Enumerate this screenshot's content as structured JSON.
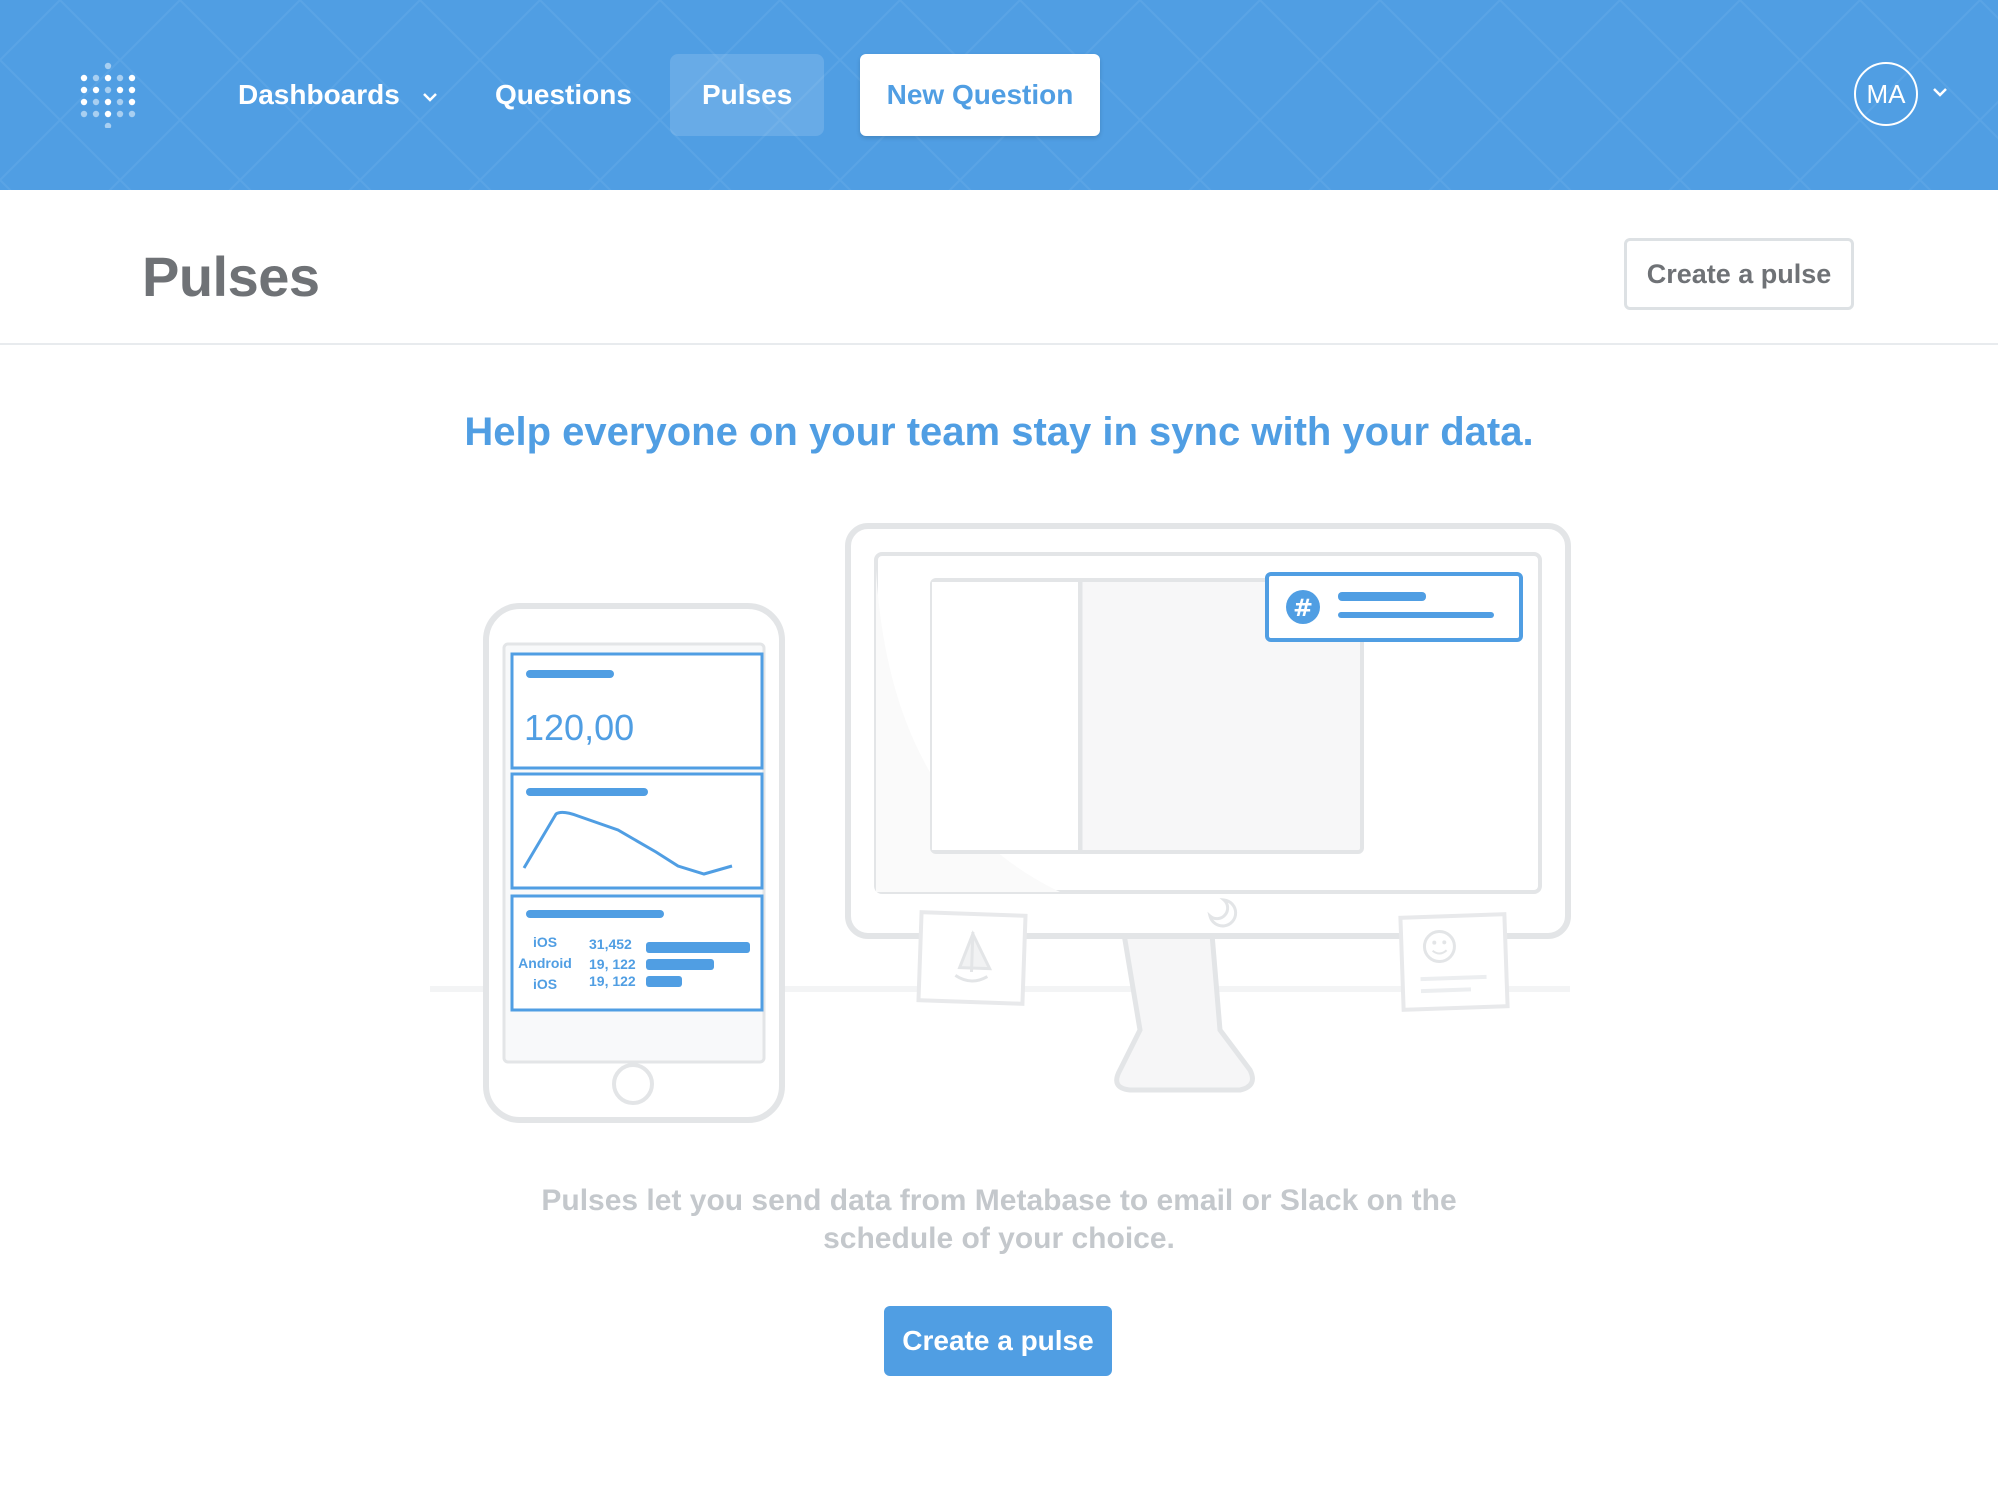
{
  "nav": {
    "items": [
      {
        "label": "Dashboards"
      },
      {
        "label": "Questions"
      },
      {
        "label": "Pulses"
      }
    ],
    "new_question_label": "New Question",
    "user_initials": "MA"
  },
  "header": {
    "title": "Pulses",
    "create_button_label": "Create a pulse"
  },
  "empty_state": {
    "headline": "Help everyone on your team stay in sync with your data.",
    "description": "Pulses let you send data from Metabase to email or Slack on the schedule of your choice.",
    "cta_label": "Create a pulse"
  },
  "illustration": {
    "phone_scalar_value": "120,00",
    "phone_rows": [
      {
        "label": "iOS",
        "value": "31,452"
      },
      {
        "label": "Android",
        "value": "19, 122"
      },
      {
        "label": "iOS",
        "value": "19, 122"
      }
    ]
  },
  "colors": {
    "brand": "#509ee3",
    "title_gray": "#6f7276",
    "muted_text": "#c4c8cc"
  }
}
